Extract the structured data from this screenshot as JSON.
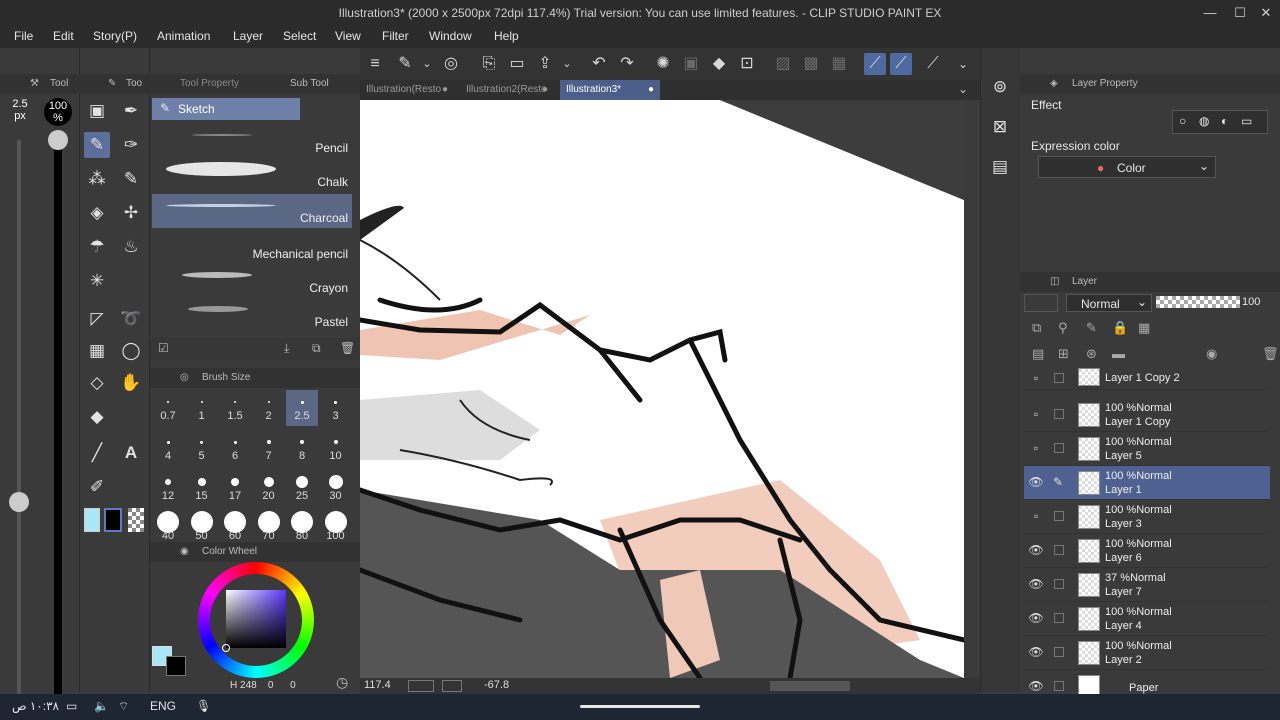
{
  "title": "Illustration3* (2000 x 2500px 72dpi 117.4%)  Trial version: You can use limited features. - CLIP STUDIO PAINT EX",
  "menu": [
    "File",
    "Edit",
    "Story(P)",
    "Animation",
    "Layer",
    "Select",
    "View",
    "Filter",
    "Window",
    "Help"
  ],
  "left": {
    "brush_size_value": "2.5",
    "brush_size_unit": "px",
    "opacity_value": "100",
    "opacity_unit": "%",
    "tool_tab": "Tool",
    "tool_tab2": "Too",
    "tool_property_tab": "Tool Property",
    "sub_tool_tab": "Sub Tool"
  },
  "subtool": {
    "group": "Sketch",
    "brushes": [
      {
        "name": "Pencil",
        "selected": false
      },
      {
        "name": "Chalk",
        "selected": false
      },
      {
        "name": "Charcoal",
        "selected": true
      },
      {
        "name": "Mechanical pencil",
        "selected": false
      },
      {
        "name": "Crayon",
        "selected": false
      },
      {
        "name": "Pastel",
        "selected": false
      }
    ]
  },
  "brush_size": {
    "title": "Brush Size",
    "sizes": [
      "0.7",
      "1",
      "1.5",
      "2",
      "2.5",
      "3",
      "4",
      "5",
      "6",
      "7",
      "8",
      "10",
      "12",
      "15",
      "17",
      "20",
      "25",
      "30",
      "40",
      "50",
      "60",
      "70",
      "80",
      "100"
    ],
    "selected": "2.5"
  },
  "color_wheel": {
    "title": "Color Wheel",
    "h": "248",
    "s": "0",
    "v": "0",
    "main_color": "#a8e6f8",
    "sub_color": "#000000"
  },
  "tabs": [
    {
      "label": "Illustration(Resto",
      "active": false
    },
    {
      "label": "Illustration2(Resto",
      "active": false
    },
    {
      "label": "Illustration3*",
      "active": true
    }
  ],
  "status": {
    "zoom": "117.4",
    "angle": "-67.8"
  },
  "layer_property": {
    "title": "Layer Property",
    "effect_label": "Effect",
    "expression_label": "Expression color",
    "expression_value": "Color"
  },
  "layer_panel": {
    "title": "Layer",
    "blend_mode": "Normal",
    "opacity": "100",
    "layers": [
      {
        "blend": "",
        "name": "Layer 1 Copy 2",
        "visible": false,
        "selected": false
      },
      {
        "blend": "100 %Normal",
        "name": "Layer 1 Copy",
        "visible": false,
        "selected": false
      },
      {
        "blend": "100 %Normal",
        "name": "Layer 5",
        "visible": false,
        "selected": false
      },
      {
        "blend": "100 %Normal",
        "name": "Layer 1",
        "visible": true,
        "selected": true
      },
      {
        "blend": "100 %Normal",
        "name": "Layer 3",
        "visible": false,
        "selected": false
      },
      {
        "blend": "100 %Normal",
        "name": "Layer 6",
        "visible": true,
        "selected": false
      },
      {
        "blend": "37 %Normal",
        "name": "Layer 7",
        "visible": true,
        "selected": false
      },
      {
        "blend": "100 %Normal",
        "name": "Layer 4",
        "visible": true,
        "selected": false
      },
      {
        "blend": "100 %Normal",
        "name": "Layer 2",
        "visible": true,
        "selected": false
      },
      {
        "blend": "",
        "name": "Paper",
        "visible": true,
        "selected": false
      }
    ]
  },
  "taskbar": {
    "time": "١٠:٣٨ ص",
    "lang": "ENG"
  }
}
